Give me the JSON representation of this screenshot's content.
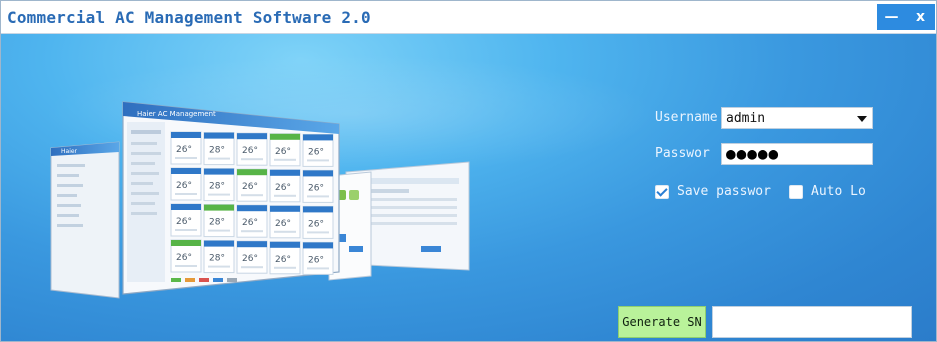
{
  "window": {
    "title": "Commercial AC Management Software 2.0",
    "controls": {
      "minimize": "—",
      "close": "x"
    }
  },
  "login": {
    "username_label": "Username",
    "username_value": "admin",
    "password_label": "Passwor",
    "password_value": "●●●●●",
    "save_password_label": "Save passwor",
    "save_password_checked": true,
    "auto_login_label": "Auto Lo",
    "auto_login_checked": false
  },
  "serial": {
    "generate_label": "Generate SN",
    "sn_value": ""
  },
  "illustration": {
    "main_window_title": "Haier AC Management",
    "tile_values": [
      "26°",
      "28°",
      "26°",
      "26°",
      "26°",
      "26°",
      "28°",
      "26°",
      "26°",
      "26°",
      "26°",
      "28°",
      "26°",
      "26°",
      "26°",
      "26°",
      "28°",
      "26°",
      "26°",
      "26°"
    ]
  },
  "colors": {
    "accent": "#2d8be0",
    "background": "#3a98df",
    "generate_button": "#b9f29a"
  }
}
